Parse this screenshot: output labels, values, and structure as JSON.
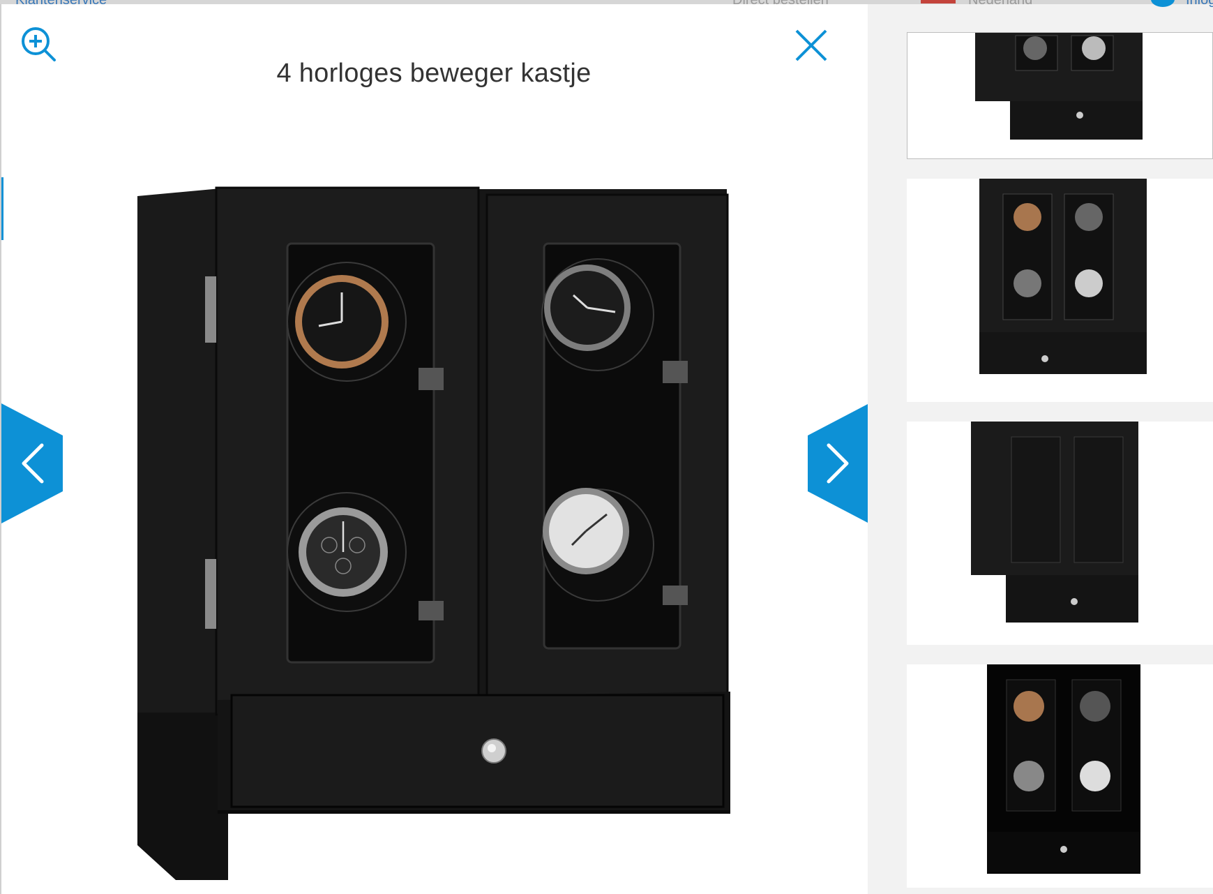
{
  "top_bar": {
    "customer_service": "Klantenservice",
    "direct_order": "Direct bestellen",
    "country": "Nederland",
    "login": "Inloggen"
  },
  "viewer": {
    "title": "4 horloges beweger kastje",
    "zoom_icon": "zoom-in-icon",
    "close_icon": "close-icon",
    "prev_icon": "chevron-left-icon",
    "next_icon": "chevron-right-icon",
    "accent_color": "#0d91d6"
  },
  "thumbnails": {
    "count": 4,
    "active_index": 0
  }
}
